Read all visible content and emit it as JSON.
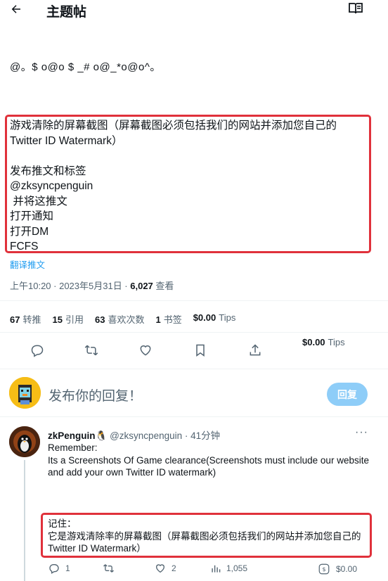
{
  "header": {
    "title": "主题帖",
    "back_icon": "arrow-left-icon",
    "reader_icon": "reader-icon"
  },
  "tweet": {
    "emoticon": "@。$ o@o $ _# o@_*o@o^。",
    "body": "游戏清除的屏幕截图（屏幕截图必须包括我们的网站并添加您自己的Twitter ID Watermark）\n\n发布推文和标签\n@zksyncpenguin\n 并将这推文\n打开通知\n打开DM\nFCFS",
    "translate_label": "翻译推文",
    "time": "上午10:20 · 2023年5月31日 · ",
    "views": "6,027",
    "views_label": " 查看"
  },
  "stats": [
    {
      "num": "67",
      "label": "转推"
    },
    {
      "num": "15",
      "label": "引用"
    },
    {
      "num": "63",
      "label": "喜欢次数"
    },
    {
      "num": "1",
      "label": "书签"
    },
    {
      "num": "$0.00",
      "label": "Tips"
    }
  ],
  "tips_float": {
    "num": "$0.00",
    "label": "Tips"
  },
  "actions": [
    "reply-icon",
    "retweet-icon",
    "like-icon",
    "bookmark-icon",
    "share-icon"
  ],
  "composer": {
    "placeholder": "发布你的回复！",
    "button": "回复"
  },
  "reply": {
    "name": "zkPenguin🐧",
    "handle": "@zksyncpenguin",
    "time": " · 41分钟",
    "more": "···",
    "text_en": "Remember:\nIts a Screenshots Of Game clearance(Screenshots must include our website and add your own Twitter ID watermark)",
    "text_zh": "记住：\n它是游戏清除率的屏幕截图（屏幕截图必须包括我们的网站并添加您自己的Twitter ID Watermark）",
    "actions": {
      "replies": "1",
      "retweets": "",
      "likes": "2",
      "views": "1,055",
      "tips": "$0.00"
    }
  },
  "colors": {
    "accent": "#1d9bf0",
    "highlight": "#e0313b",
    "muted": "#536471"
  }
}
